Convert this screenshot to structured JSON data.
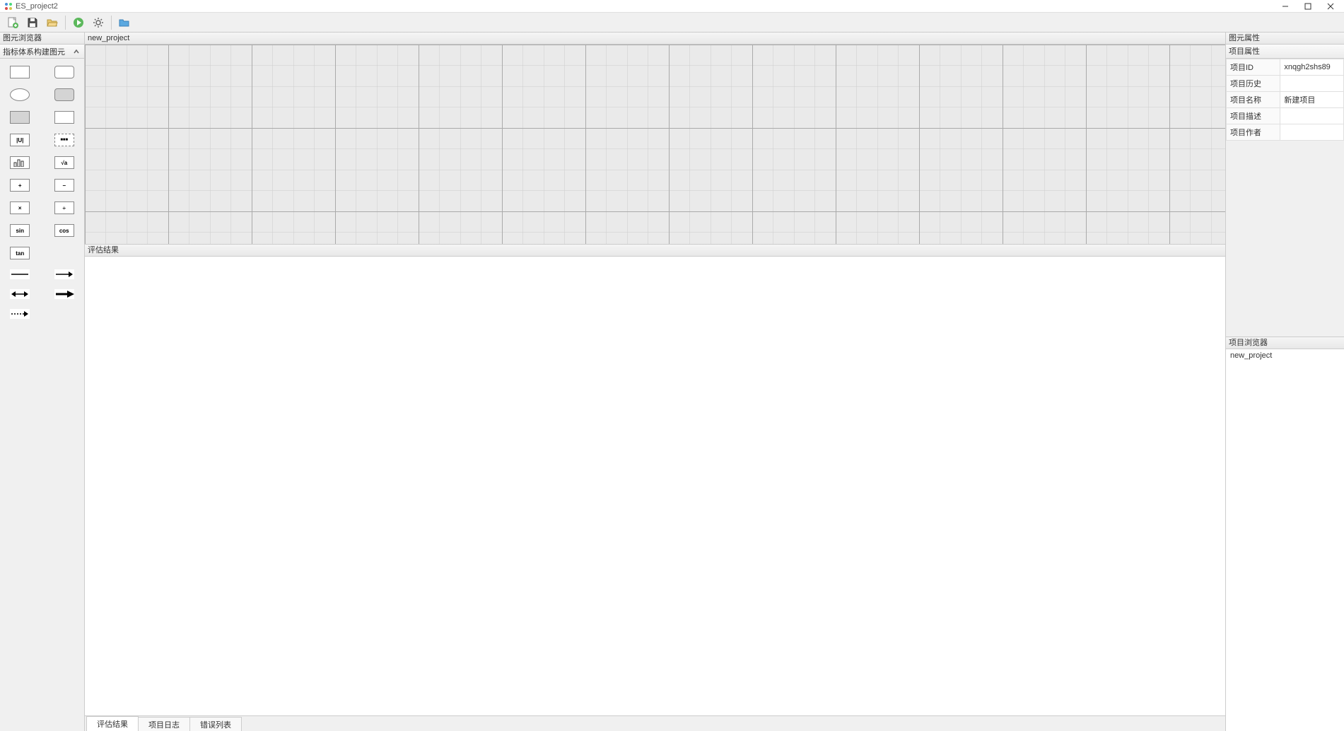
{
  "window": {
    "title": "ES_project2"
  },
  "toolbar": {
    "new": "new",
    "save": "save",
    "open": "open",
    "play": "play",
    "settings": "settings",
    "folder": "folder"
  },
  "left_panel": {
    "header": "图元浏览器",
    "category": "指标体系构建图元"
  },
  "canvas": {
    "tab": "new_project"
  },
  "results": {
    "header": "评估结果"
  },
  "bottom_tabs": {
    "t1": "评估结果",
    "t2": "项目日志",
    "t3": "错误列表"
  },
  "right_panel": {
    "header": "图元属性",
    "project_props_header": "项目属性",
    "props": {
      "id_label": "项目ID",
      "id_value": "xnqgh2shs89",
      "history_label": "项目历史",
      "history_value": "",
      "name_label": "项目名称",
      "name_value": "新建项目",
      "desc_label": "项目描述",
      "desc_value": "",
      "author_label": "项目作者",
      "author_value": ""
    },
    "browser_header": "项目浏览器",
    "browser_item": "new_project"
  }
}
